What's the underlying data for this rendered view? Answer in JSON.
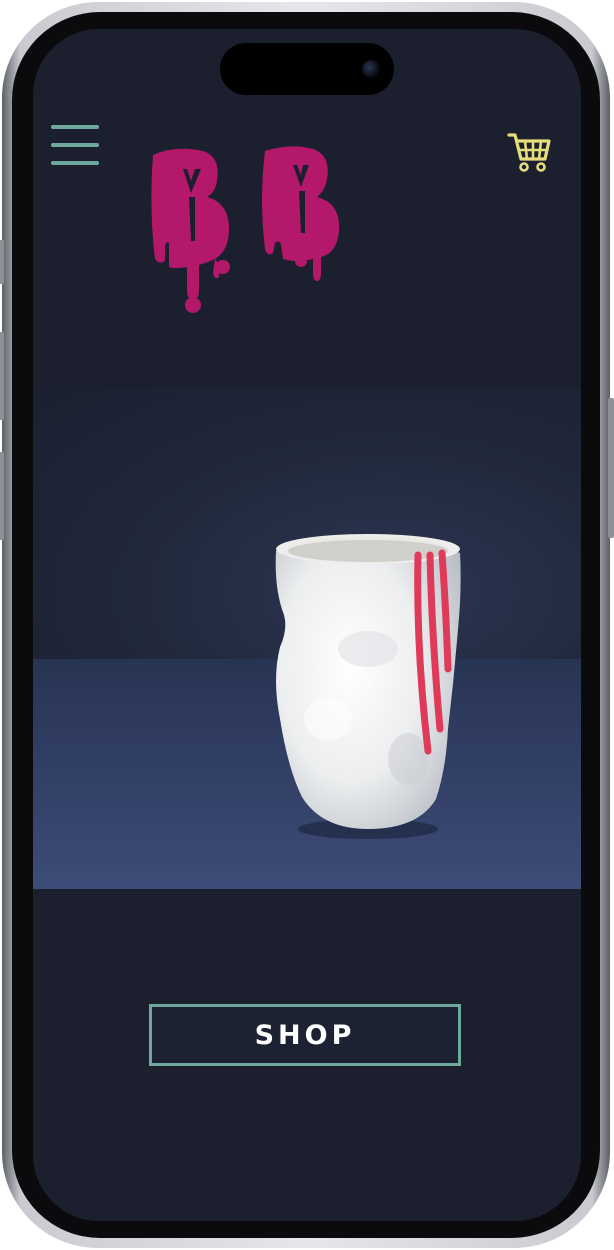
{
  "header": {
    "menu_icon": "hamburger-menu-icon",
    "cart_icon": "shopping-cart-icon",
    "logo_text": "BB"
  },
  "hero": {
    "image_subject": "white-ceramic-vase-with-red-drips"
  },
  "cta": {
    "shop_label": "SHOP"
  },
  "colors": {
    "background": "#1b1f2e",
    "accent_teal": "#6fa89c",
    "cart_yellow": "#e6de7a",
    "logo_magenta": "#b3186b",
    "drip_red": "#e03a5a"
  }
}
